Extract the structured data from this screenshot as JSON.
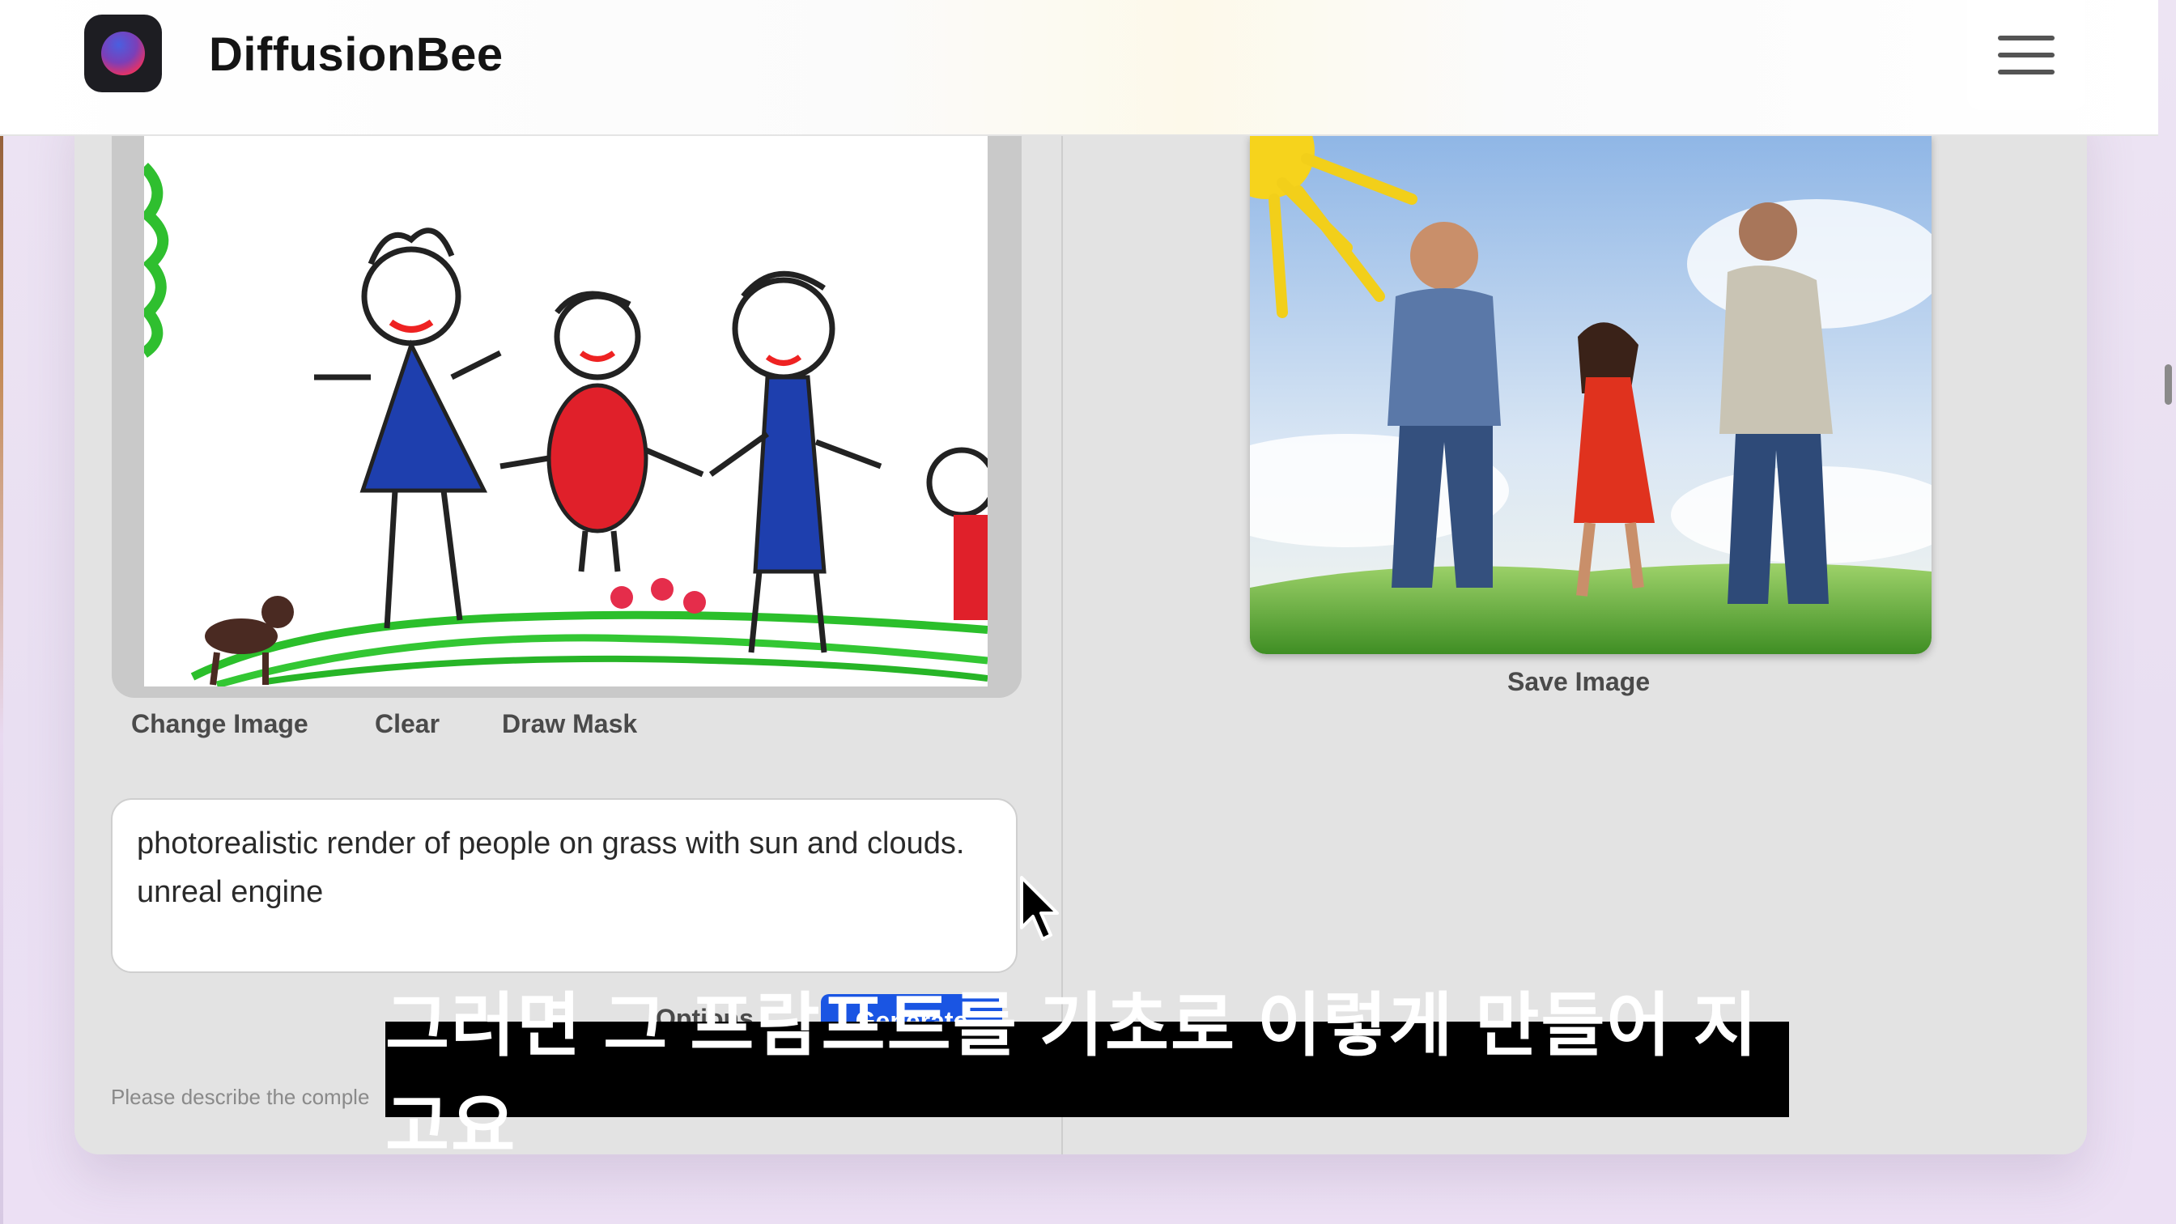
{
  "app": {
    "title": "DiffusionBee",
    "icon": "diffusionbee-logo-icon"
  },
  "header": {
    "menu_icon": "hamburger-menu-icon"
  },
  "input_panel": {
    "image_description": "child crayon drawing of family on green grass",
    "actions": {
      "change_image": "Change Image",
      "clear": "Clear",
      "draw_mask": "Draw Mask"
    },
    "prompt": {
      "value": "photorealistic render of people on grass with sun and clouds. unreal engine"
    },
    "options_label": "Options",
    "generate_label": "Generate",
    "hint": "Please describe the comple"
  },
  "output_panel": {
    "save_label": "Save Image"
  },
  "subtitle": {
    "text": "그러면 그 프람프트를 기초로 이렇게 만들어 지고요"
  },
  "colors": {
    "accent": "#1a55e3",
    "panel_bg": "#e3e3e3",
    "page_bg": "#ede4f3"
  }
}
